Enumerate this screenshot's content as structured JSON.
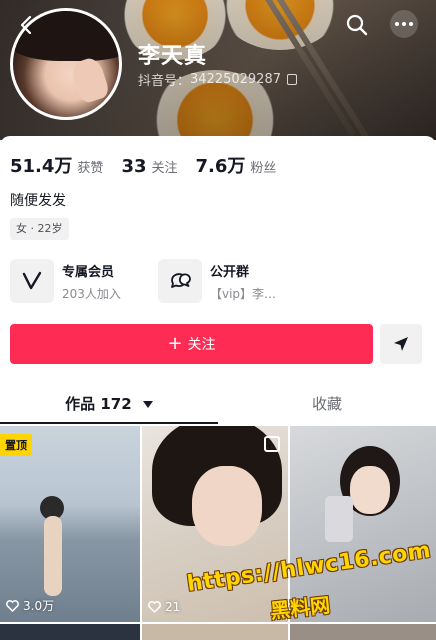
{
  "header": {
    "nickname": "李天真",
    "account_label": "抖音号：",
    "account_id": "34225029287",
    "icons": [
      "back-icon",
      "search-icon",
      "more-icon",
      "copy-icon"
    ]
  },
  "stats": [
    {
      "num": "51.4万",
      "label": "获赞"
    },
    {
      "num": "33",
      "label": "关注"
    },
    {
      "num": "7.6万",
      "label": "粉丝"
    }
  ],
  "bio": "随便发发",
  "tag": "女 · 22岁",
  "features": [
    {
      "title": "专属会员",
      "sub": "203人加入",
      "icon": "v-member-icon"
    },
    {
      "title": "公开群",
      "sub": "【vip】李…",
      "icon": "group-chat-icon"
    }
  ],
  "follow_label": "关注",
  "tabs": {
    "works_label": "作品",
    "works_count": "172",
    "favorites_label": "收藏"
  },
  "videos": [
    {
      "pinned_label": "置顶",
      "likes": "3.0万"
    },
    {
      "likes": "21",
      "multi_image": true
    },
    {
      "likes": ""
    }
  ],
  "watermark": {
    "url": "https://hlwc16.com",
    "name": "黑料网"
  },
  "colors": {
    "accent": "#fe2c55",
    "pin_badge": "#ffd400",
    "text": "#161823",
    "muted": "#6b6d75"
  }
}
